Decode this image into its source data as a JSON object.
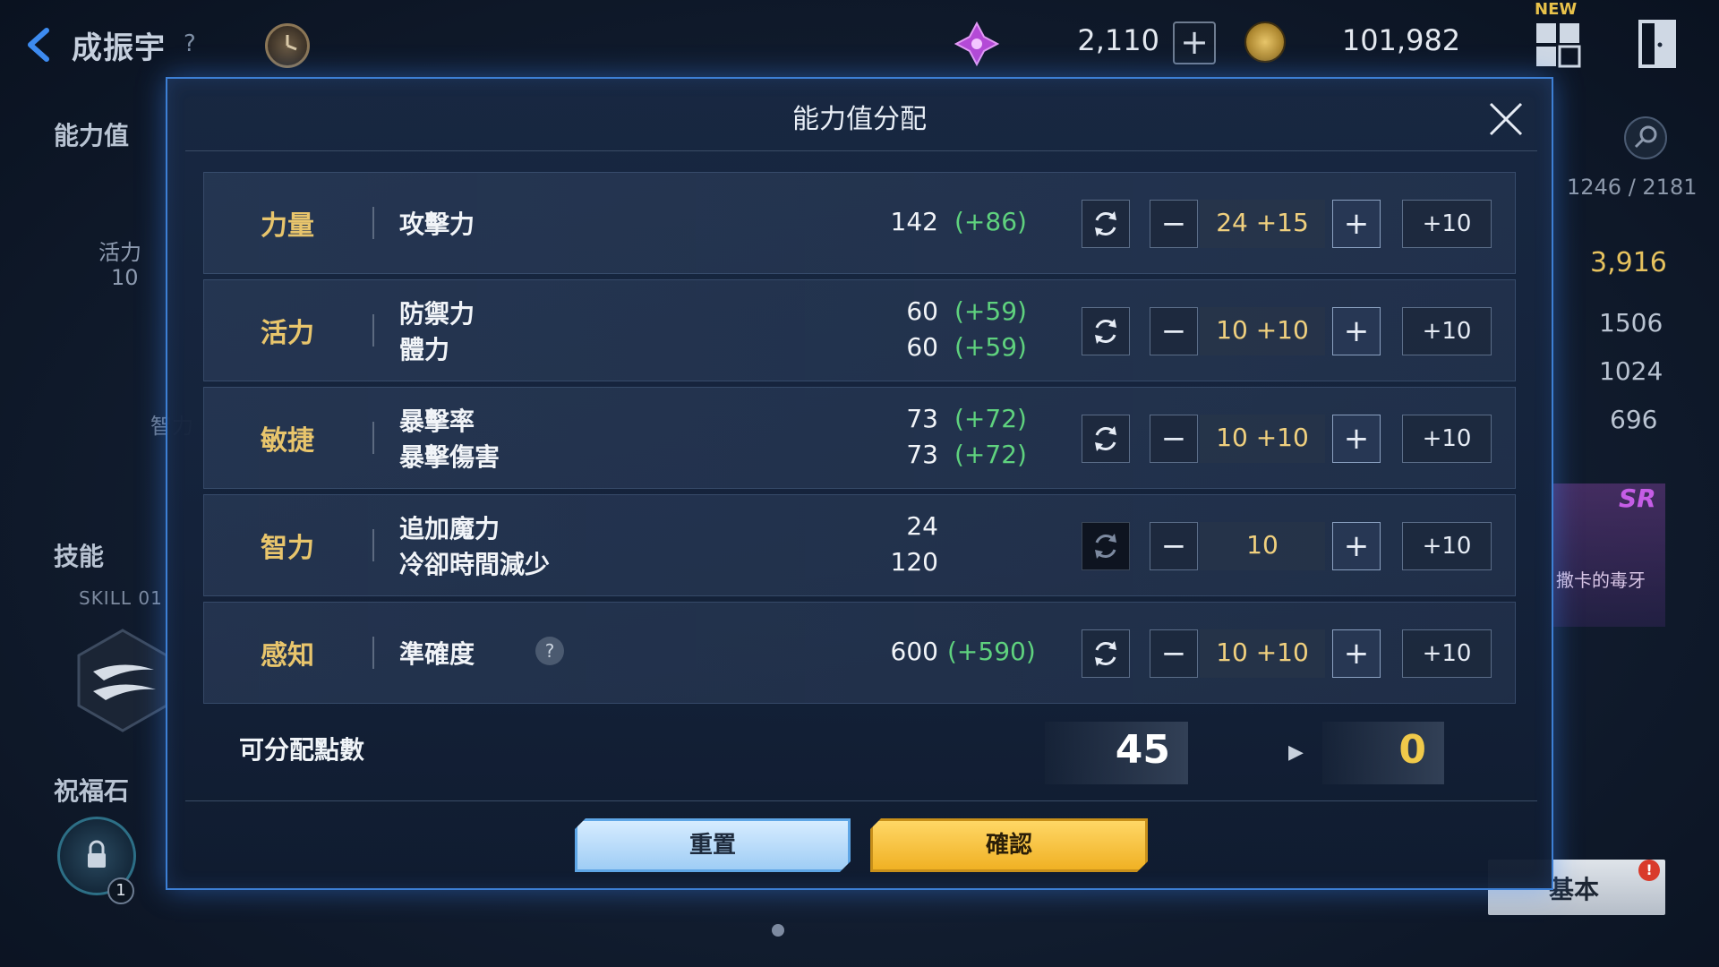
{
  "topbar": {
    "player_name": "成振宇",
    "help_mark": "?",
    "gems": "2,110",
    "gem_plus": "+",
    "gold": "101,982",
    "new_badge": "NEW"
  },
  "left_panel": {
    "stats_label": "能力值",
    "vitality_label": "活力",
    "vitality_value": "10",
    "intellect_label": "智力",
    "skill_label": "技能",
    "skill_slot": "SKILL 01",
    "blessing_label": "祝福石",
    "lock_badge": "1"
  },
  "right_panel": {
    "exp": "1246 / 2181",
    "combat_power": "3,916",
    "values": [
      "1506",
      "1024",
      "696"
    ],
    "card_rank": "SR",
    "card_name": "撒卡的毒牙",
    "basic_tab": "基本",
    "alert": "!"
  },
  "modal": {
    "title": "能力值分配",
    "rows": [
      {
        "stat": "力量",
        "attrs": [
          {
            "name": "攻擊力",
            "value": "142",
            "bonus": "(+86)"
          }
        ],
        "points": "24 +15",
        "reset_enabled": true
      },
      {
        "stat": "活力",
        "attrs": [
          {
            "name": "防禦力",
            "value": "60",
            "bonus": "(+59)"
          },
          {
            "name": "體力",
            "value": "60",
            "bonus": "(+59)"
          }
        ],
        "points": "10 +10",
        "reset_enabled": true
      },
      {
        "stat": "敏捷",
        "attrs": [
          {
            "name": "暴擊率",
            "value": "73",
            "bonus": "(+72)"
          },
          {
            "name": "暴擊傷害",
            "value": "73",
            "bonus": "(+72)"
          }
        ],
        "points": "10 +10",
        "reset_enabled": true
      },
      {
        "stat": "智力",
        "attrs": [
          {
            "name": "追加魔力",
            "value": "24",
            "bonus": ""
          },
          {
            "name": "冷卻時間減少",
            "value": "120",
            "bonus": ""
          }
        ],
        "points": "10",
        "reset_enabled": false
      },
      {
        "stat": "感知",
        "attrs": [
          {
            "name": "準確度",
            "value": "600",
            "bonus": "(+590)",
            "help": "?"
          }
        ],
        "points": "10 +10",
        "reset_enabled": true
      }
    ],
    "controls": {
      "minus": "−",
      "plus": "+",
      "plus_ten": "+10"
    },
    "allocatable_label": "可分配點數",
    "allocatable_before": "45",
    "allocatable_after": "0",
    "reset_button": "重置",
    "confirm_button": "確認"
  }
}
